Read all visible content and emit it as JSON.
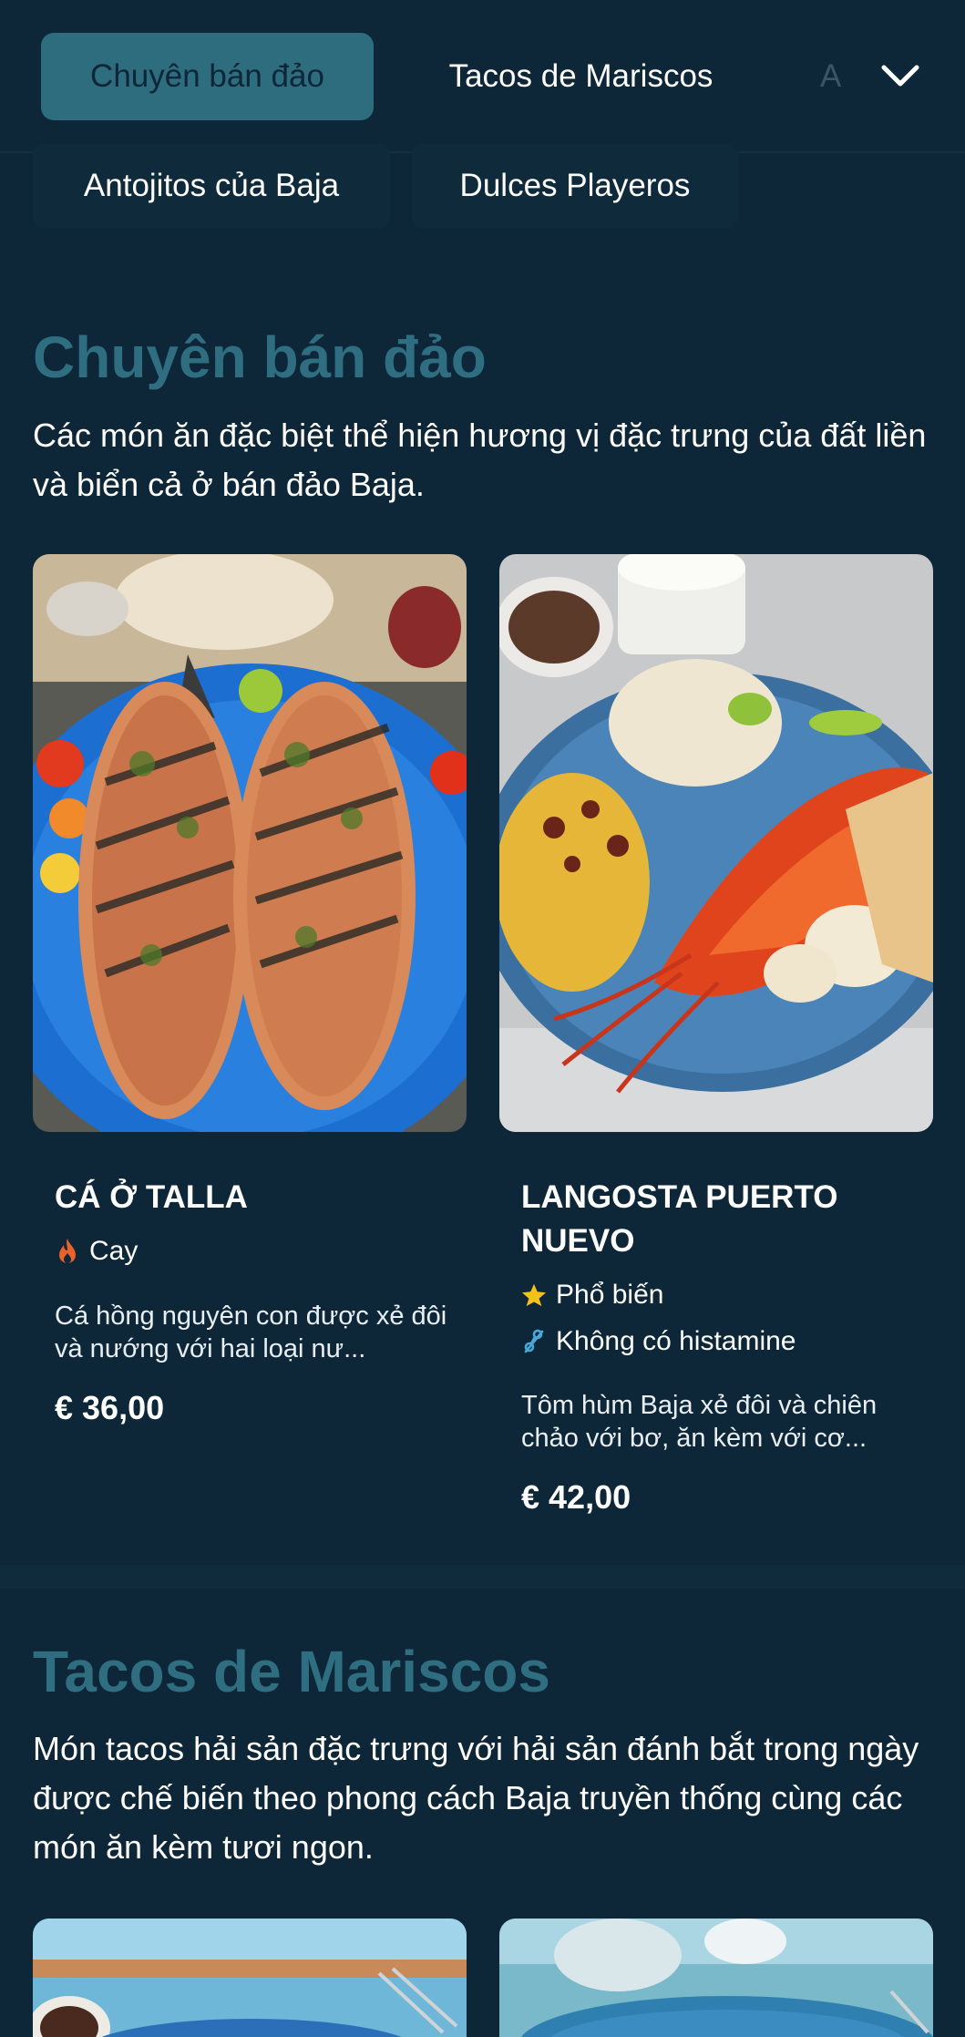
{
  "nav": {
    "tabs": [
      {
        "label": "Chuyên bán đảo",
        "active": true
      },
      {
        "label": "Tacos de Mariscos",
        "active": false
      },
      {
        "label": "A",
        "active": false
      },
      {
        "label": "Antojitos của Baja",
        "active": false
      },
      {
        "label": "Dulces Playeros",
        "active": false
      }
    ],
    "expand_icon": "chevron-down-icon"
  },
  "sections": [
    {
      "title": "Chuyên bán đảo",
      "description": "Các món ăn đặc biệt thể hiện hương vị đặc trưng của đất liền và biển cả ở bán đảo Baja.",
      "items": [
        {
          "name": "CÁ Ở TALLA",
          "tags": [
            {
              "icon": "flame-icon",
              "label": "Cay"
            }
          ],
          "description": "Cá hồng nguyên con được xẻ đôi và nướng với hai loại nư...",
          "price": "€ 36,00"
        },
        {
          "name": "LANGOSTA PUERTO NUEVO",
          "tags": [
            {
              "icon": "star-icon",
              "label": "Phổ biến"
            },
            {
              "icon": "histamine-icon",
              "label": "Không có histamine"
            }
          ],
          "description": "Tôm hùm Baja xẻ đôi và chiên chảo với bơ, ăn kèm với cơ...",
          "price": "€ 42,00"
        }
      ]
    },
    {
      "title": "Tacos de Mariscos",
      "description": "Món tacos hải sản đặc trưng với hải sản đánh bắt trong ngày được chế biến theo phong cách Baja truyền thống cùng các món ăn kèm tươi ngon."
    }
  ],
  "colors": {
    "background": "#0d2638",
    "accent": "#2e6d7e",
    "flame": "#e8622a",
    "star": "#f2c21b",
    "histamine": "#4aa8d8"
  }
}
